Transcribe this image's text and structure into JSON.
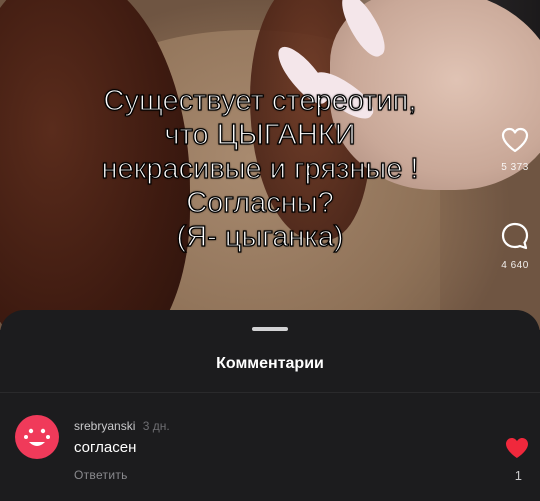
{
  "video": {
    "caption_lines": [
      "Существует стереотип,",
      "что ЦЫГАНКИ",
      "некрасивые и грязные !",
      "Согласны?",
      "(Я- цыганка)"
    ],
    "likes_count": "5 373",
    "comments_count": "4 640",
    "like_icon": "heart-outline-icon",
    "comment_icon": "speech-bubble-icon"
  },
  "comments_sheet": {
    "title": "Комментарии",
    "comments": [
      {
        "author": "srebryanski",
        "time": "3 дн.",
        "text": "согласен",
        "reply_label": "Ответить",
        "likes": "1",
        "avatar_icon": "smiley-face-icon",
        "avatar_color": "#f03a5a",
        "like_icon": "heart-filled-icon",
        "like_color": "#f0283c"
      }
    ]
  }
}
